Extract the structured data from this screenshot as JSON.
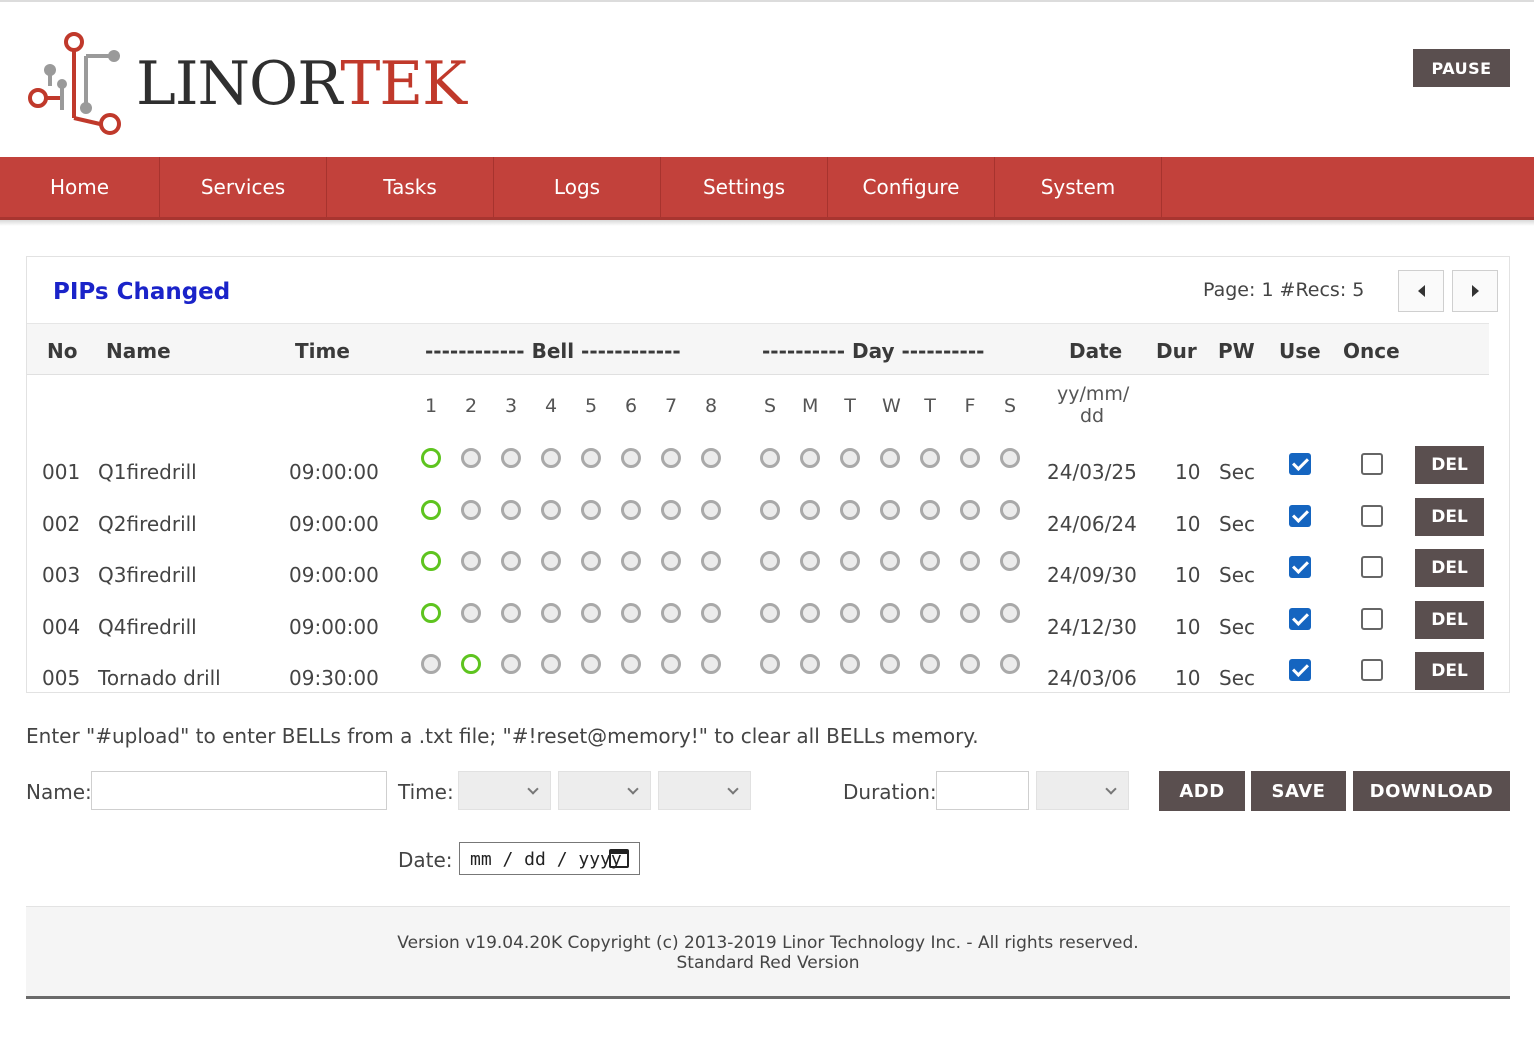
{
  "header": {
    "logo_text_dark": "LINOR",
    "logo_text_red": "TEK",
    "pause_label": "PAUSE"
  },
  "nav": {
    "items": [
      "Home",
      "Services",
      "Tasks",
      "Logs",
      "Settings",
      "Configure",
      "System"
    ]
  },
  "panel": {
    "title": "PIPs Changed",
    "page_label": "Page: 1",
    "recs_label": "#Recs: 5",
    "columns": {
      "no": "No",
      "name": "Name",
      "time": "Time",
      "bell": "------------ Bell ------------",
      "day": "---------- Day ----------",
      "date": "Date",
      "dur": "Dur",
      "pw": "PW",
      "use": "Use",
      "once": "Once"
    },
    "bell_numbers": [
      "1",
      "2",
      "3",
      "4",
      "5",
      "6",
      "7",
      "8"
    ],
    "day_letters": [
      "S",
      "M",
      "T",
      "W",
      "T",
      "F",
      "S"
    ],
    "date_format_line1": "yy/mm/",
    "date_format_line2": "dd",
    "rows": [
      {
        "no": "001",
        "name": "Q1firedrill",
        "time": "09:00:00",
        "bells": [
          1,
          0,
          0,
          0,
          0,
          0,
          0,
          0
        ],
        "days": [
          0,
          0,
          0,
          0,
          0,
          0,
          0
        ],
        "date": "24/03/25",
        "dur": "10",
        "pw": "Sec",
        "use": true,
        "once": false,
        "del": "DEL"
      },
      {
        "no": "002",
        "name": "Q2firedrill",
        "time": "09:00:00",
        "bells": [
          1,
          0,
          0,
          0,
          0,
          0,
          0,
          0
        ],
        "days": [
          0,
          0,
          0,
          0,
          0,
          0,
          0
        ],
        "date": "24/06/24",
        "dur": "10",
        "pw": "Sec",
        "use": true,
        "once": false,
        "del": "DEL"
      },
      {
        "no": "003",
        "name": "Q3firedrill",
        "time": "09:00:00",
        "bells": [
          1,
          0,
          0,
          0,
          0,
          0,
          0,
          0
        ],
        "days": [
          0,
          0,
          0,
          0,
          0,
          0,
          0
        ],
        "date": "24/09/30",
        "dur": "10",
        "pw": "Sec",
        "use": true,
        "once": false,
        "del": "DEL"
      },
      {
        "no": "004",
        "name": "Q4firedrill",
        "time": "09:00:00",
        "bells": [
          1,
          0,
          0,
          0,
          0,
          0,
          0,
          0
        ],
        "days": [
          0,
          0,
          0,
          0,
          0,
          0,
          0
        ],
        "date": "24/12/30",
        "dur": "10",
        "pw": "Sec",
        "use": true,
        "once": false,
        "del": "DEL"
      },
      {
        "no": "005",
        "name": "Tornado drill",
        "time": "09:30:00",
        "bells": [
          0,
          1,
          0,
          0,
          0,
          0,
          0,
          0
        ],
        "days": [
          0,
          0,
          0,
          0,
          0,
          0,
          0
        ],
        "date": "24/03/06",
        "dur": "10",
        "pw": "Sec",
        "use": true,
        "once": false,
        "del": "DEL"
      }
    ]
  },
  "form": {
    "hint": "Enter \"#upload\" to enter BELLs from a .txt file; \"#!reset@memory!\" to clear all BELLs memory.",
    "name_label": "Name:",
    "name_value": "",
    "time_label": "Time:",
    "duration_label": "Duration:",
    "duration_value": "",
    "date_label": "Date:",
    "date_placeholder": "mm / dd / yyyy",
    "add_label": "ADD",
    "save_label": "SAVE",
    "download_label": "DOWNLOAD"
  },
  "footer": {
    "line1": "Version v19.04.20K Copyright (c) 2013-2019 Linor Technology Inc. - All rights reserved.",
    "line2": "Standard Red Version"
  },
  "colors": {
    "nav_bg": "#c2413b",
    "button_bg": "#5a4f4f",
    "title_blue": "#1a23c9",
    "active_dot": "#5ec41f",
    "checkbox_blue": "#1565c0"
  }
}
